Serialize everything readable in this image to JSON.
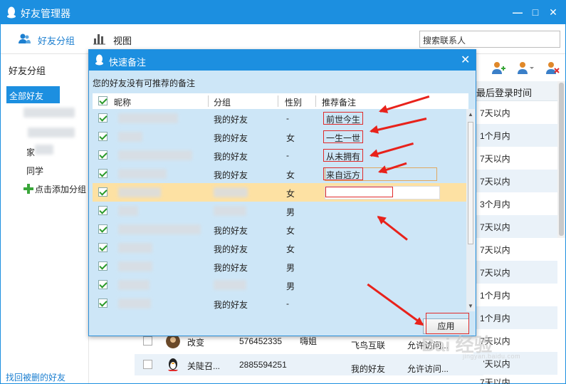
{
  "window": {
    "title": "好友管理器"
  },
  "toolbar": {
    "group_label": "好友分组",
    "view_label": "视图",
    "search_placeholder": "搜索联系人"
  },
  "sidebar": {
    "header": "好友分组",
    "all_friends": "全部好友(25)",
    "groups": [
      "家",
      "同学"
    ],
    "add_group": "点击添加分组",
    "recover": "找回被删的好友"
  },
  "background_table": {
    "last_login_header": "最后登录时间",
    "last_login": [
      "7天以内",
      "1个月内",
      "7天以内",
      "7天以内",
      "7天以内",
      "3个月内",
      "7天以内",
      "7天以内",
      "7天以内",
      "1个月内",
      "1个月内",
      "7天以内",
      "7天以内",
      "7天以内"
    ],
    "rows": [
      {
        "name": "改变",
        "qq": "576452335",
        "remark": "嗨姐",
        "group": "飞鸟互联",
        "perm": "允许访问..."
      },
      {
        "name": "关陡召...",
        "qq": "2885594251",
        "remark": "",
        "group": "我的好友",
        "perm": "允许访问..."
      }
    ]
  },
  "dialog": {
    "title": "快速备注",
    "note": "您的好友没有可推荐的备注",
    "headers": {
      "nick": "昵称",
      "group": "分组",
      "gender": "性别",
      "remark": "推荐备注"
    },
    "rows": [
      {
        "group": "我的好友",
        "gender": "-",
        "remark": "前世今生"
      },
      {
        "group": "我的好友",
        "gender": "女",
        "remark": "一生一世"
      },
      {
        "group": "我的好友",
        "gender": "-",
        "remark": "从未拥有"
      },
      {
        "group": "我的好友",
        "gender": "女",
        "remark": "来自远方"
      },
      {
        "group": "",
        "gender": "女",
        "remark": ""
      },
      {
        "group": "",
        "gender": "男",
        "remark": ""
      },
      {
        "group": "我的好友",
        "gender": "女",
        "remark": ""
      },
      {
        "group": "我的好友",
        "gender": "女",
        "remark": ""
      },
      {
        "group": "我的好友",
        "gender": "男",
        "remark": ""
      },
      {
        "group": "",
        "gender": "男",
        "remark": ""
      },
      {
        "group": "我的好友",
        "gender": "-",
        "remark": ""
      }
    ],
    "apply_label": "应用"
  },
  "watermark": {
    "brand": "Bai 经验",
    "url": "jingyan.baidu.com"
  },
  "colors": {
    "accent": "#1c8fe0",
    "annotation_red": "#e8221b",
    "selected_row": "#fde1a3",
    "dialog_bg": "#cde6f7"
  }
}
